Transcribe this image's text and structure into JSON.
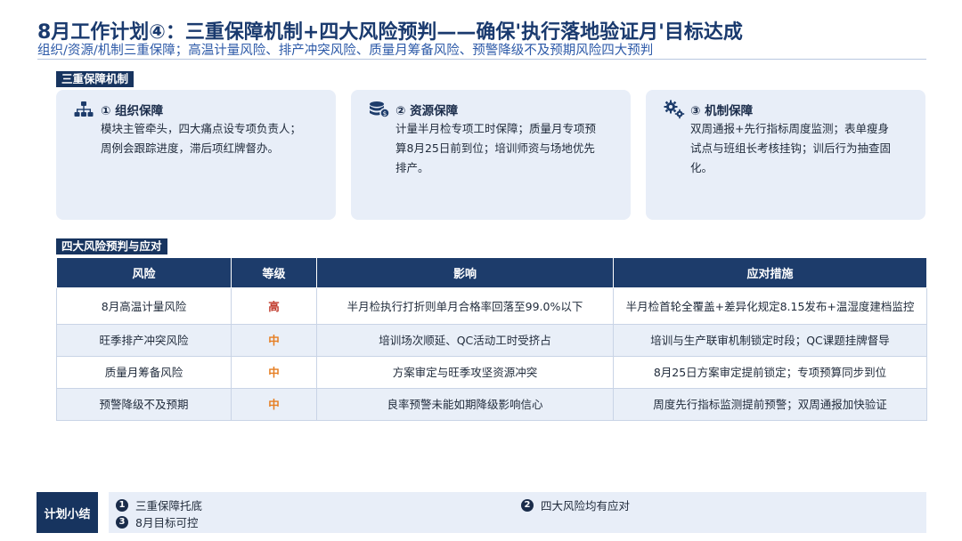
{
  "header": {
    "title": "8月工作计划④：三重保障机制+四大风险预判——确保'执行落地验证月'目标达成",
    "subtitle": "组织/资源/机制三重保障；高温计量风险、排产冲突风险、质量月筹备风险、预警降级不及预期风险四大预判"
  },
  "sections": {
    "guarantee": "三重保障机制",
    "risks": "四大风险预判与应对"
  },
  "cards": [
    {
      "icon": "org-chart-icon",
      "title": "① 组织保障",
      "lines": [
        "模块主管牵头，四大痛点设专项负责人；",
        "周例会跟踪进度，滞后项红牌督办。"
      ]
    },
    {
      "icon": "coin-stack-icon",
      "title": "② 资源保障",
      "lines": [
        "计量半月检专项工时保障；质量月专项预",
        "算8月25日前到位；培训师资与场地优先",
        "排产。"
      ]
    },
    {
      "icon": "gears-icon",
      "title": "③ 机制保障",
      "lines": [
        "双周通报+先行指标周度监测；表单瘦身",
        "试点与班组长考核挂钩；训后行为抽查固",
        "化。"
      ]
    }
  ],
  "table": {
    "headers": [
      "风险",
      "等级",
      "影响",
      "应对措施"
    ],
    "rows": [
      {
        "risk": "8月高温计量风险",
        "level": "高",
        "impact": "半月检执行打折则单月合格率回落至99.0%以下",
        "measure": "半月检首轮全覆盖+差异化规定8.15发布+温湿度建档监控"
      },
      {
        "risk": "旺季排产冲突风险",
        "level": "中",
        "impact": "培训场次顺延、QC活动工时受挤占",
        "measure": "培训与生产联审机制锁定时段；QC课题挂牌督导"
      },
      {
        "risk": "质量月筹备风险",
        "level": "中",
        "impact": "方案审定与旺季攻坚资源冲突",
        "measure": "8月25日方案审定提前锁定；专项预算同步到位"
      },
      {
        "risk": "预警降级不及预期",
        "level": "中",
        "impact": "良率预警未能如期降级影响信心",
        "measure": "周度先行指标监测提前预警；双周通报加快验证"
      }
    ]
  },
  "summary": {
    "label": "计划小结",
    "items": [
      {
        "num": "1",
        "text": "三重保障托底"
      },
      {
        "num": "2",
        "text": "四大风险均有应对"
      },
      {
        "num": "3",
        "text": "8月目标可控"
      }
    ]
  },
  "colors": {
    "navy": "#17345f",
    "table_header": "#1d3c6b",
    "card_bg": "#e8eef8",
    "level_high": "#c0392b",
    "level_mid": "#e67e22"
  }
}
